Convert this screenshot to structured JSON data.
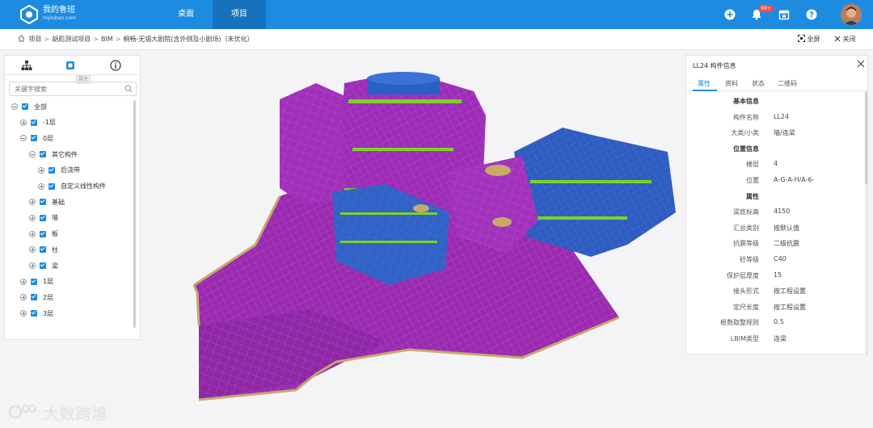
{
  "topbar": {
    "brand_name": "我的鲁班",
    "brand_url": "myluban.com",
    "tabs": [
      {
        "label": "桌面",
        "active": false
      },
      {
        "label": "项目",
        "active": true
      }
    ],
    "notification_badge": "99+",
    "color": "#1d8ce0"
  },
  "breadcrumb": {
    "items": [
      "项目",
      "胡彪测试项目",
      "BIM",
      "桐畅-无锡大剧院(含外侧及小剧场)（未优化）"
    ],
    "separator": ">",
    "fullscreen_label": "全屏",
    "close_label": "关闭"
  },
  "left_panel": {
    "tooltip": "属性",
    "search": {
      "placeholder": "关键字搜索",
      "value": ""
    },
    "tree": [
      {
        "label": "全部",
        "level": 0,
        "expander": "minus"
      },
      {
        "label": "-1层",
        "level": 1,
        "expander": "plus"
      },
      {
        "label": "0层",
        "level": 1,
        "expander": "minus"
      },
      {
        "label": "其它构件",
        "level": 2,
        "expander": "minus"
      },
      {
        "label": "后浇带",
        "level": 3,
        "expander": "plus"
      },
      {
        "label": "自定义线性构件",
        "level": 3,
        "expander": "plus"
      },
      {
        "label": "基础",
        "level": 2,
        "expander": "plus"
      },
      {
        "label": "墙",
        "level": 2,
        "expander": "plus"
      },
      {
        "label": "板",
        "level": 2,
        "expander": "plus"
      },
      {
        "label": "柱",
        "level": 2,
        "expander": "plus"
      },
      {
        "label": "梁",
        "level": 2,
        "expander": "plus"
      },
      {
        "label": "1层",
        "level": 1,
        "expander": "plus"
      },
      {
        "label": "2层",
        "level": 1,
        "expander": "plus"
      },
      {
        "label": "3层",
        "level": 1,
        "expander": "plus"
      }
    ]
  },
  "right_panel": {
    "title": "LL24 构件信息",
    "tabs": [
      "属性",
      "资料",
      "状态",
      "二维码"
    ],
    "active_tab": "属性",
    "rows": [
      {
        "group": "基本信息"
      },
      {
        "key": "构件名称",
        "value": "LL24"
      },
      {
        "key": "大类/小类",
        "value": "墙/连梁"
      },
      {
        "group": "位置信息"
      },
      {
        "key": "楼层",
        "value": "4"
      },
      {
        "key": "位置",
        "value": "A-G-A-H/A-6-"
      },
      {
        "group": "属性"
      },
      {
        "key": "梁底标高",
        "value": "4150"
      },
      {
        "key": "汇总类别",
        "value": "按默认值"
      },
      {
        "key": "抗震等级",
        "value": "二级抗震"
      },
      {
        "key": "砼等级",
        "value": "C40"
      },
      {
        "key": "保护层厚度",
        "value": "15"
      },
      {
        "key": "接头形式",
        "value": "按工程设置"
      },
      {
        "key": "定尺长度",
        "value": "按工程设置"
      },
      {
        "key": "根数取整规则",
        "value": "0.5"
      },
      {
        "key": "LBIM类型",
        "value": "连梁"
      }
    ]
  },
  "watermark": "大数跨境",
  "model_colors": {
    "slab": "#9a2bb0",
    "wall": "#2a5fc4",
    "accent": "#7ed321",
    "edge": "#c8a96a"
  }
}
